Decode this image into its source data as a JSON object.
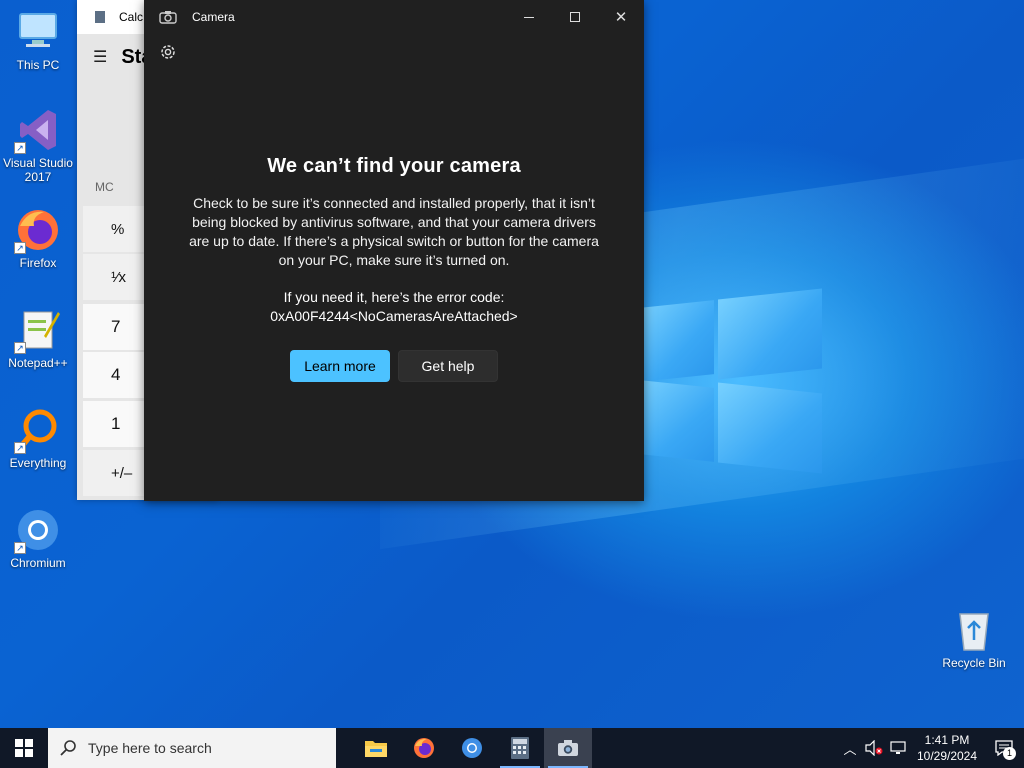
{
  "desktop": {
    "icons": [
      {
        "label": "This PC",
        "icon": "computer-icon"
      },
      {
        "label": "Visual Studio\n2017",
        "icon": "visual-studio-icon"
      },
      {
        "label": "Firefox",
        "icon": "firefox-icon"
      },
      {
        "label": "Notepad++",
        "icon": "notepadpp-icon"
      },
      {
        "label": "Everything",
        "icon": "everything-icon"
      },
      {
        "label": "Chromium",
        "icon": "chromium-icon"
      },
      {
        "label": "Recycle Bin",
        "icon": "recycle-bin-icon"
      }
    ]
  },
  "calculator": {
    "title": "Calc",
    "mode": "Sta",
    "memory": "MC",
    "buttons": [
      "%",
      "¹⁄x",
      "7",
      "4",
      "1",
      "+/–"
    ]
  },
  "camera": {
    "title": "Camera",
    "heading": "We can’t find your camera",
    "body": "Check to be sure it’s connected and installed properly, that it isn’t being blocked by antivirus software, and that your camera drivers are up to date. If there’s a physical switch or button for the camera on your PC, make sure it’s turned on.",
    "error_label": "If you need it, here’s the error code:",
    "error_code": "0xA00F4244<NoCamerasAreAttached>",
    "learn_more": "Learn more",
    "get_help": "Get help",
    "accent": "#4cc2ff"
  },
  "taskbar": {
    "search_placeholder": "Type here to search",
    "apps": [
      "file-explorer-icon",
      "firefox-icon",
      "chromium-icon",
      "calculator-icon",
      "camera-icon"
    ],
    "time": "1:41 PM",
    "date": "10/29/2024",
    "notification_count": "1"
  }
}
